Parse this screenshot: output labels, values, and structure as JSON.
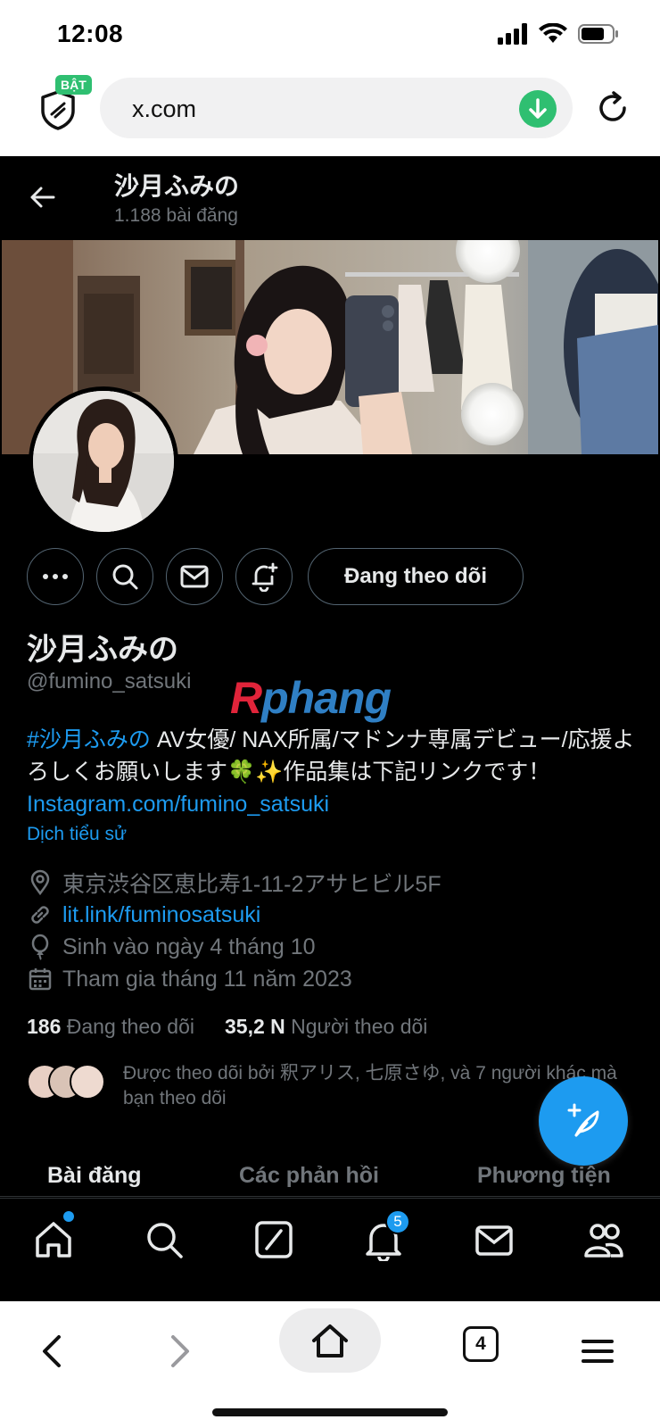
{
  "status_bar": {
    "time": "12:08"
  },
  "browser": {
    "shield_badge": "BẬT",
    "url": "x.com",
    "tab_count": "4"
  },
  "profile": {
    "header_name": "沙月ふみの",
    "post_count": "1.188 bài đăng",
    "display_name": "沙月ふみの",
    "handle": "@fumino_satsuki",
    "follow_button": "Đang theo dõi",
    "bio_hashtag": "#沙月ふみの",
    "bio_text": " AV女優/ NAX所属/マドンナ専属デビュー/応援よろしくお願いします🍀✨作品集は下記リンクです！ ",
    "bio_link": "Instagram.com/fumino_satsuki",
    "translate": "Dịch tiểu sử",
    "location": "東京渋谷区恵比寿1-11-2アサヒビル5F",
    "website": "lit.link/fuminosatsuki",
    "birthday": "Sinh vào ngày 4 tháng 10",
    "joined": "Tham gia tháng 11 năm 2023",
    "following_count": "186",
    "following_label": "Đang theo dõi",
    "followers_count": "35,2 N",
    "followers_label": "Người theo dõi",
    "followed_by": "Được theo dõi bởi 釈アリス, 七原さゆ, và 7 người khác mà bạn theo dõi"
  },
  "watermark": {
    "first": "R",
    "rest": "phang"
  },
  "tabs": [
    "Bài đăng",
    "Các phản hồi",
    "Phương tiện"
  ],
  "bottom_nav": {
    "notification_count": "5"
  },
  "colors": {
    "accent": "#1d9bf0",
    "muted": "#71767b",
    "text": "#e7e9ea",
    "bg": "#000000",
    "badge_green": "#2fbf71"
  }
}
